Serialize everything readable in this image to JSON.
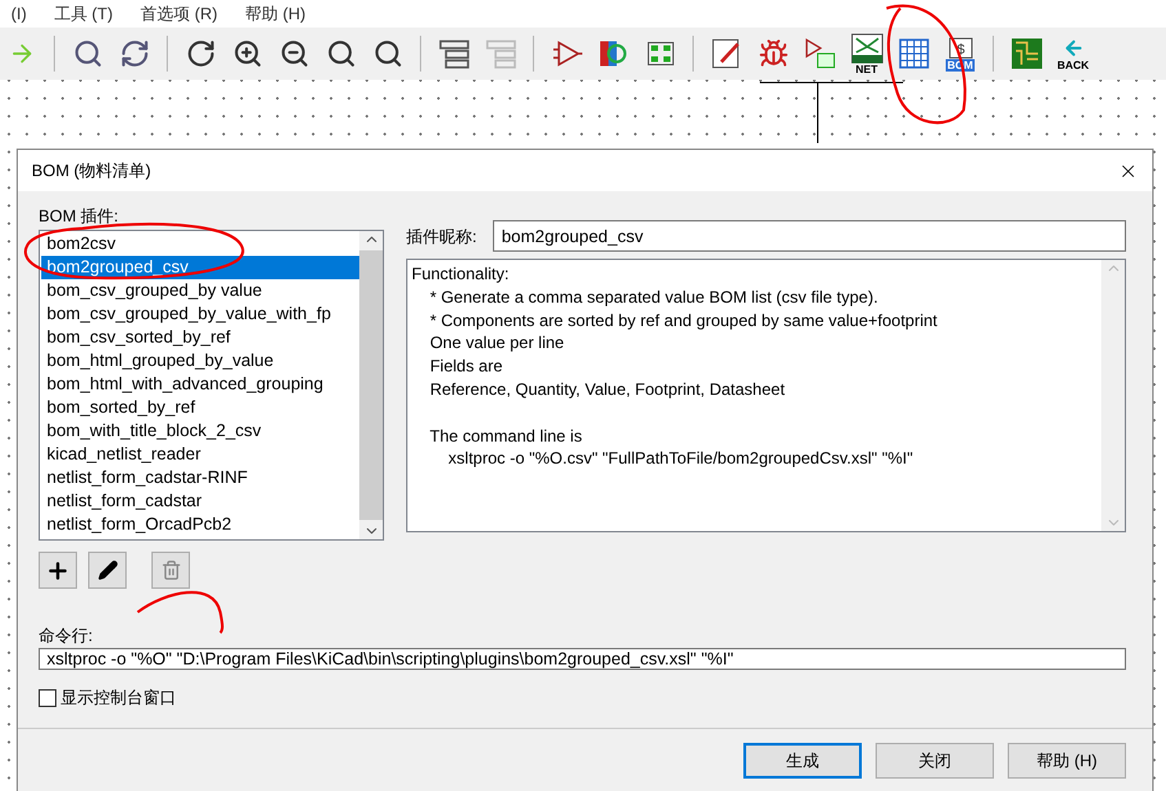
{
  "menubar": [
    "(I)",
    "工具 (T)",
    "首选项 (R)",
    "帮助 (H)"
  ],
  "toolbar": [
    {
      "kind": "arrow"
    },
    {
      "kind": "separator"
    },
    {
      "kind": "zoom-page"
    },
    {
      "kind": "refresh"
    },
    {
      "kind": "separator"
    },
    {
      "kind": "rotate"
    },
    {
      "kind": "zoom-in"
    },
    {
      "kind": "zoom-out"
    },
    {
      "kind": "zoom-fit"
    },
    {
      "kind": "zoom-area"
    },
    {
      "kind": "separator"
    },
    {
      "kind": "hierarchy"
    },
    {
      "kind": "leave-sheet"
    },
    {
      "kind": "separator"
    },
    {
      "kind": "symbol"
    },
    {
      "kind": "library"
    },
    {
      "kind": "footprint"
    },
    {
      "kind": "separator"
    },
    {
      "kind": "annotate"
    },
    {
      "kind": "bug"
    },
    {
      "kind": "assign"
    },
    {
      "kind": "net",
      "label": "NET"
    },
    {
      "kind": "table"
    },
    {
      "kind": "bom",
      "symbol": "$",
      "label": "BOM"
    },
    {
      "kind": "separator"
    },
    {
      "kind": "pcb"
    },
    {
      "kind": "back",
      "label": "BACK"
    }
  ],
  "dialog": {
    "title": "BOM (物料清单)",
    "plugins_label": "BOM 插件:",
    "plugins": [
      {
        "name": "bom2csv",
        "selected": false
      },
      {
        "name": "bom2grouped_csv",
        "selected": true
      },
      {
        "name": "bom_csv_grouped_by value",
        "selected": false
      },
      {
        "name": "bom_csv_grouped_by_value_with_fp",
        "selected": false
      },
      {
        "name": "bom_csv_sorted_by_ref",
        "selected": false
      },
      {
        "name": "bom_html_grouped_by_value",
        "selected": false
      },
      {
        "name": "bom_html_with_advanced_grouping",
        "selected": false
      },
      {
        "name": "bom_sorted_by_ref",
        "selected": false
      },
      {
        "name": "bom_with_title_block_2_csv",
        "selected": false
      },
      {
        "name": "kicad_netlist_reader",
        "selected": false
      },
      {
        "name": "netlist_form_cadstar-RINF",
        "selected": false
      },
      {
        "name": "netlist_form_cadstar",
        "selected": false
      },
      {
        "name": "netlist_form_OrcadPcb2",
        "selected": false
      }
    ],
    "nickname_label": "插件昵称:",
    "nickname": "bom2grouped_csv",
    "description": "Functionality:\n    * Generate a comma separated value BOM list (csv file type).\n    * Components are sorted by ref and grouped by same value+footprint\n    One value per line\n    Fields are\n    Reference, Quantity, Value, Footprint, Datasheet\n\n    The command line is\n        xsltproc -o \"%O.csv\" \"FullPathToFile/bom2groupedCsv.xsl\" \"%I\"",
    "command_label": "命令行:",
    "command": "xsltproc -o \"%O\" \"D:\\Program Files\\KiCad\\bin\\scripting\\plugins\\bom2grouped_csv.xsl\" \"%I\"",
    "console_checkbox": {
      "label": "显示控制台窗口",
      "checked": false
    },
    "buttons": [
      {
        "label": "生成",
        "default": true
      },
      {
        "label": "关闭",
        "default": false
      },
      {
        "label": "帮助 (H)",
        "default": false
      }
    ]
  }
}
